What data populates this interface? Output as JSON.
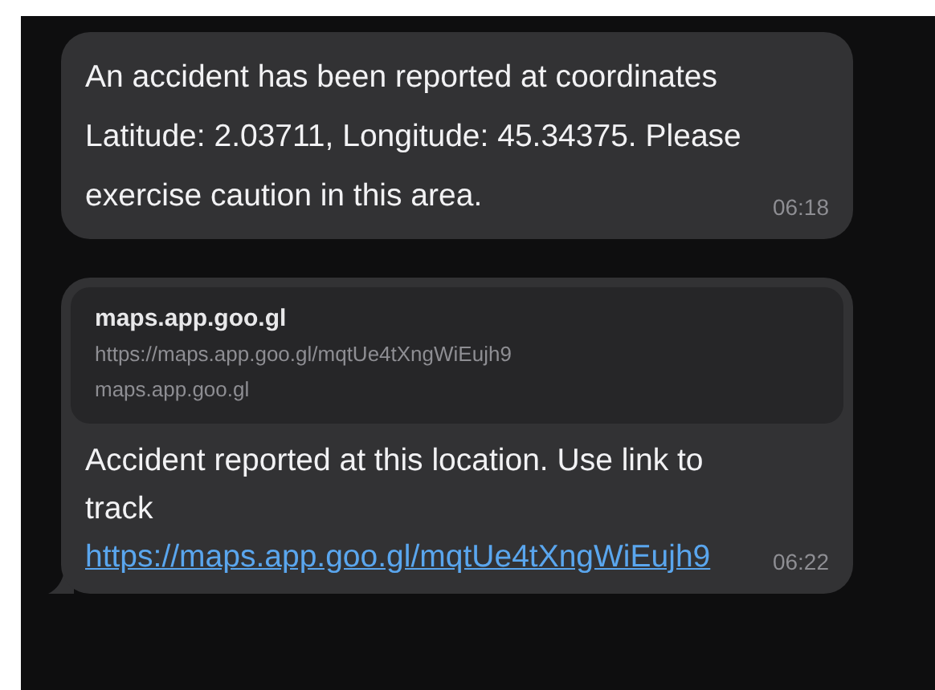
{
  "messages": [
    {
      "kind": "text",
      "text": "An accident has been reported at coordinates Latitude: 2.03711, Longitude: 45.34375. Please exercise caution in this area.",
      "time": "06:18",
      "tail": false
    },
    {
      "kind": "link",
      "preview": {
        "title": "maps.app.goo.gl",
        "url": "https://maps.app.goo.gl/mqtUe4tXngWiEujh9",
        "domain": "maps.app.goo.gl"
      },
      "text": "Accident reported at this location. Use link to track",
      "link": "https://maps.app.goo.gl/mqtUe4tXngWiEujh9",
      "time": "06:22",
      "tail": true
    }
  ]
}
